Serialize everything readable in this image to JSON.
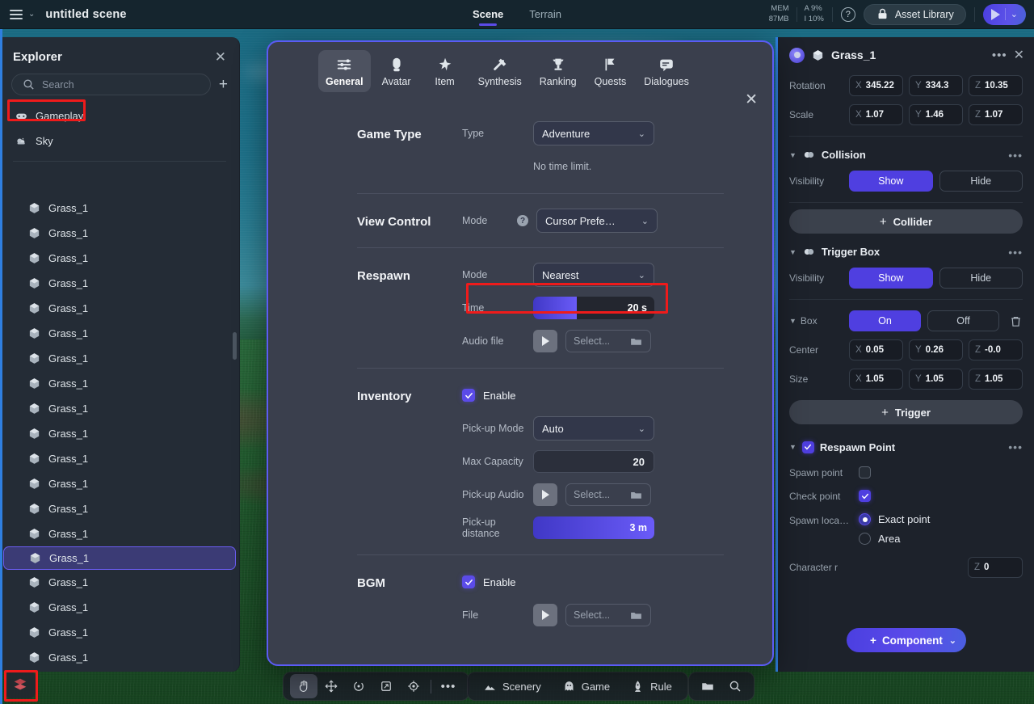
{
  "topbar": {
    "menu_icon": "hamburger-icon",
    "menu_chevron": "⌄",
    "scene_title": "untitled scene",
    "tabs": [
      {
        "label": "Scene",
        "active": true
      },
      {
        "label": "Terrain",
        "active": false
      }
    ],
    "stats": {
      "mem_label": "MEM",
      "mem_value": "87MB",
      "audio_label": "A 9%",
      "io_label": "I 10%"
    },
    "help_icon": "question-mark-icon",
    "asset_library_label": "Asset Library",
    "asset_lock_icon": "lock-icon",
    "play_icon": "play-icon",
    "play_chevron": "⌄"
  },
  "explorer": {
    "title": "Explorer",
    "close_icon": "close-icon",
    "search": {
      "value": "",
      "placeholder": "Search"
    },
    "add_label": "+",
    "top_items": [
      {
        "label": "Gameplay",
        "icon": "gamepad-icon",
        "highlighted": true
      },
      {
        "label": "Sky",
        "icon": "cloud-icon",
        "highlighted": false
      }
    ],
    "objects": [
      {
        "label": "Grass_1",
        "selected": false
      },
      {
        "label": "Grass_1",
        "selected": false
      },
      {
        "label": "Grass_1",
        "selected": false
      },
      {
        "label": "Grass_1",
        "selected": false
      },
      {
        "label": "Grass_1",
        "selected": false
      },
      {
        "label": "Grass_1",
        "selected": false
      },
      {
        "label": "Grass_1",
        "selected": false
      },
      {
        "label": "Grass_1",
        "selected": false
      },
      {
        "label": "Grass_1",
        "selected": false
      },
      {
        "label": "Grass_1",
        "selected": false
      },
      {
        "label": "Grass_1",
        "selected": false
      },
      {
        "label": "Grass_1",
        "selected": false
      },
      {
        "label": "Grass_1",
        "selected": false
      },
      {
        "label": "Grass_1",
        "selected": false
      },
      {
        "label": "Grass_1",
        "selected": true
      },
      {
        "label": "Grass_1",
        "selected": false
      },
      {
        "label": "Grass_1",
        "selected": false
      },
      {
        "label": "Grass_1",
        "selected": false
      },
      {
        "label": "Grass_1",
        "selected": false
      }
    ]
  },
  "dialog": {
    "close_icon": "close-icon",
    "tabs": [
      {
        "label": "General",
        "icon": "sliders-icon",
        "active": true
      },
      {
        "label": "Avatar",
        "icon": "avatar-icon",
        "active": false
      },
      {
        "label": "Item",
        "icon": "item-star-icon",
        "active": false
      },
      {
        "label": "Synthesis",
        "icon": "hammer-icon",
        "active": false
      },
      {
        "label": "Ranking",
        "icon": "trophy-icon",
        "active": false
      },
      {
        "label": "Quests",
        "icon": "flag-icon",
        "active": false
      },
      {
        "label": "Dialogues",
        "icon": "speech-bubble-icon",
        "active": false
      }
    ],
    "game_type": {
      "title": "Game Type",
      "type_label": "Type",
      "type_value": "Adventure",
      "note": "No time limit."
    },
    "view_control": {
      "title": "View Control",
      "mode_label": "Mode",
      "help_icon": "question-mark-icon",
      "mode_value": "Cursor Prefe…"
    },
    "respawn": {
      "title": "Respawn",
      "mode_label": "Mode",
      "mode_value": "Nearest",
      "time_label": "Time",
      "time_value": "20 s",
      "time_percent": 36,
      "audio_label": "Audio file",
      "audio_play_icon": "play-icon",
      "audio_value": "Select...",
      "audio_folder_icon": "folder-icon"
    },
    "inventory": {
      "title": "Inventory",
      "enable_label": "Enable",
      "enable_checked": true,
      "pickup_mode_label": "Pick-up Mode",
      "pickup_mode_value": "Auto",
      "max_capacity_label": "Max Capacity",
      "max_capacity_value": "20",
      "pickup_audio_label": "Pick-up Audio",
      "pickup_audio_play_icon": "play-icon",
      "pickup_audio_value": "Select...",
      "pickup_audio_folder_icon": "folder-icon",
      "pickup_distance_label": "Pick-up distance",
      "pickup_distance_value": "3 m",
      "pickup_distance_percent": 100
    },
    "bgm": {
      "title": "BGM",
      "enable_label": "Enable",
      "enable_checked": true,
      "file_label": "File",
      "file_play_icon": "play-icon",
      "file_value": "Select...",
      "file_folder_icon": "folder-icon"
    }
  },
  "properties": {
    "object_name": "Grass_1",
    "object_icon": "cube-icon",
    "more_icon": "more-dots-icon",
    "close_icon": "close-icon",
    "rotation": {
      "label": "Rotation",
      "x": "345.22",
      "y": "334.3",
      "z": "10.35"
    },
    "scale": {
      "label": "Scale",
      "x": "1.07",
      "y": "1.46",
      "z": "1.07"
    },
    "collision": {
      "title": "Collision",
      "icon": "collision-icon",
      "visibility_label": "Visibility",
      "show_label": "Show",
      "hide_label": "Hide",
      "visibility_value": "Show",
      "add_collider_label": "Collider",
      "add_icon": "plus-icon"
    },
    "trigger_box": {
      "title": "Trigger Box",
      "icon": "collision-icon",
      "visibility_label": "Visibility",
      "show_label": "Show",
      "hide_label": "Hide",
      "visibility_value": "Show",
      "box_label": "Box",
      "on_label": "On",
      "off_label": "Off",
      "box_value": "On",
      "delete_icon": "trash-icon",
      "center_label": "Center",
      "center": {
        "x": "0.05",
        "y": "0.26",
        "z": "-0.0"
      },
      "size_label": "Size",
      "size": {
        "x": "1.05",
        "y": "1.05",
        "z": "1.05"
      },
      "add_trigger_label": "Trigger",
      "add_icon": "plus-icon"
    },
    "respawn_point": {
      "title": "Respawn Point",
      "checked": true,
      "spawn_point_label": "Spawn point",
      "spawn_point_checked": false,
      "check_point_label": "Check point",
      "check_point_checked": true,
      "spawn_location_label": "Spawn loca…",
      "options": [
        {
          "label": "Exact point",
          "selected": true
        },
        {
          "label": "Area",
          "selected": false
        }
      ],
      "character_label": "Character r",
      "character_z": "0"
    },
    "add_component_label": "Component",
    "add_component_icon": "plus-icon",
    "add_component_chevron": "⌄"
  },
  "bottom_toolbar": {
    "tools": [
      {
        "icon": "hand-icon",
        "active": true
      },
      {
        "icon": "move-icon",
        "active": false
      },
      {
        "icon": "rotate-icon",
        "active": false
      },
      {
        "icon": "scale-icon",
        "active": false
      },
      {
        "icon": "pivot-icon",
        "active": false
      },
      {
        "icon": "more-dots-icon",
        "active": false
      }
    ],
    "modes": [
      {
        "label": "Scenery",
        "icon": "mountains-icon"
      },
      {
        "label": "Game",
        "icon": "ghost-icon"
      },
      {
        "label": "Rule",
        "icon": "rocket-icon"
      }
    ],
    "right_icons": [
      {
        "icon": "folder-icon"
      },
      {
        "icon": "search-icon"
      }
    ],
    "layers_icon": "layers-icon"
  },
  "colors": {
    "accent": "#5b4be8",
    "annotation": "#ef1b1b",
    "panel_bg": "#242c36",
    "dialog_bg": "#3a3f4d",
    "props_bg": "#1d222b",
    "viewport_sky": "#2a7d92",
    "viewport_ground": "#235e31"
  }
}
